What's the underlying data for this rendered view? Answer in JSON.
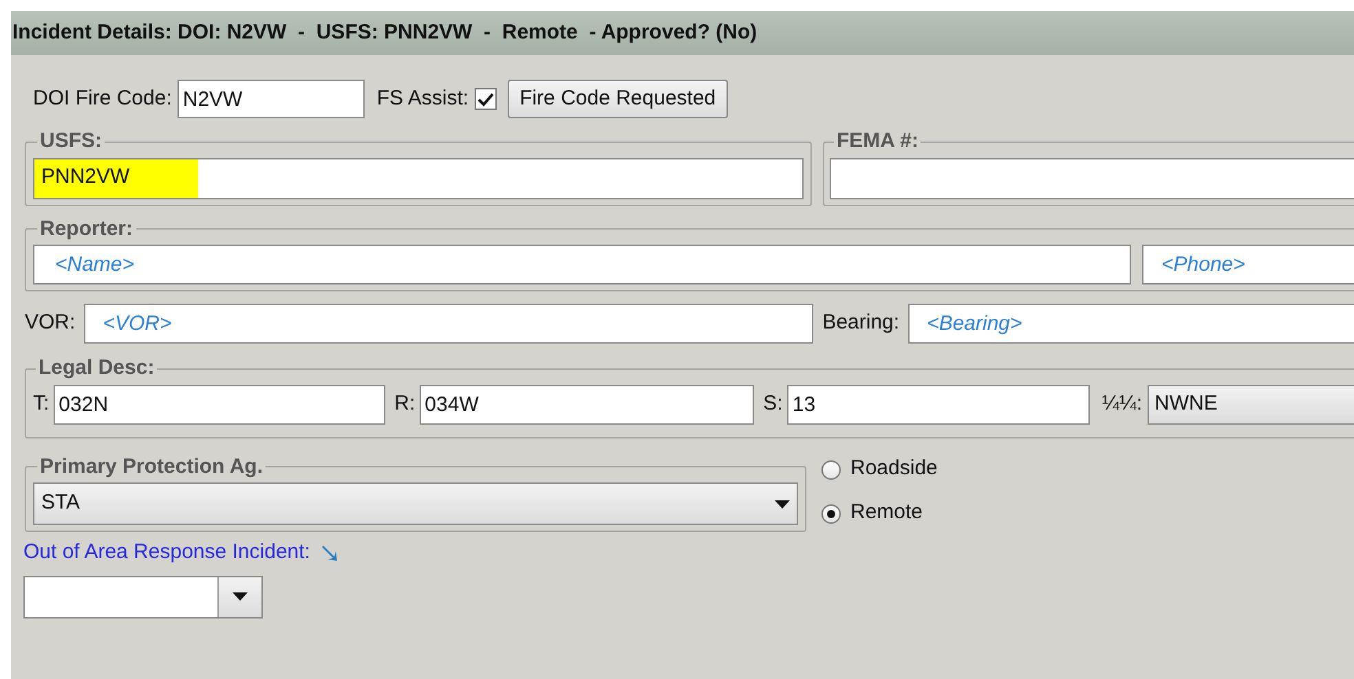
{
  "header": {
    "title": "Incident Details: DOI: N2VW  -  USFS: PNN2VW  -  Remote  - Approved? (No)"
  },
  "doi_fire_code": {
    "label": "DOI Fire Code:",
    "value": "N2VW"
  },
  "fs_assist": {
    "label": "FS Assist:",
    "checked": true
  },
  "fire_code_button": {
    "label": "Fire Code Requested"
  },
  "usfs": {
    "legend": "USFS:",
    "value": "PNN2VW",
    "highlighted": true
  },
  "fema": {
    "legend": "FEMA #:"
  },
  "reporter": {
    "legend": "Reporter:",
    "name_placeholder": "<Name>",
    "phone_placeholder": "<Phone>"
  },
  "vor": {
    "label": "VOR:",
    "placeholder": "<VOR>"
  },
  "bearing": {
    "label": "Bearing:",
    "placeholder": "<Bearing>"
  },
  "legal_desc": {
    "legend": "Legal Desc:",
    "fields": [
      {
        "label": "T:",
        "value": "032N"
      },
      {
        "label": "R:",
        "value": "034W"
      },
      {
        "label": "S:",
        "value": "13"
      }
    ],
    "quarter": {
      "label": "¼¼:",
      "value": "NWNE"
    }
  },
  "primary_protection": {
    "legend": "Primary Protection Ag.",
    "value": "STA"
  },
  "location_type": [
    {
      "label": "Roadside",
      "selected": false
    },
    {
      "label": "Remote",
      "selected": true
    }
  ],
  "out_of_area": {
    "label": "Out of Area Response Incident:"
  }
}
